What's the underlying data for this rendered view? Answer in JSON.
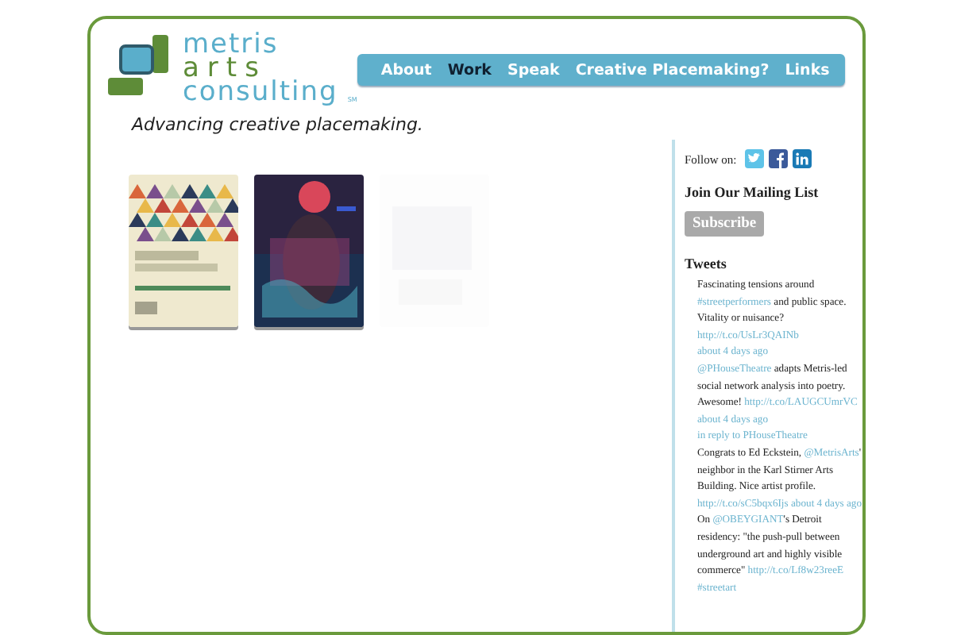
{
  "logo": {
    "lines": [
      "metris",
      "arts",
      "consulting"
    ],
    "mark": "SM"
  },
  "tagline": "Advancing creative placemaking.",
  "nav": [
    {
      "label": "About",
      "selected": false
    },
    {
      "label": "Work",
      "selected": true
    },
    {
      "label": "Speak",
      "selected": false
    },
    {
      "label": "Creative Placemaking?",
      "selected": false
    },
    {
      "label": "Links",
      "selected": false
    }
  ],
  "sidebar": {
    "follow_label": "Follow on:",
    "mailing_title": "Join Our Mailing List",
    "subscribe": "Subscribe",
    "tweets_title": "Tweets",
    "tweets": [
      [
        {
          "kind": "text",
          "text": "Fascinating tensions around "
        },
        {
          "kind": "link",
          "text": "#streetperformers"
        },
        {
          "kind": "text",
          "text": " and public space. Vitality or nuisance? "
        },
        {
          "kind": "link",
          "text": "http://t.co/UsLr3QAINb"
        },
        {
          "kind": "link",
          "text": "about 4 days ago"
        }
      ],
      [
        {
          "kind": "link",
          "text": "@PHouseTheatre"
        },
        {
          "kind": "text",
          "text": " adapts Metris-led social network analysis into poetry. Awesome! "
        },
        {
          "kind": "link",
          "text": "http://t.co/LAUGCUmrVC"
        },
        {
          "kind": "link",
          "text": "about 4 days ago"
        },
        {
          "kind": "link",
          "text": "in reply to PHouseTheatre"
        }
      ],
      [
        {
          "kind": "text",
          "text": "Congrats to Ed Eckstein, "
        },
        {
          "kind": "link",
          "text": "@MetrisArts"
        },
        {
          "kind": "text",
          "text": "' neighbor in the Karl Stirner Arts Building. Nice artist profile. "
        },
        {
          "kind": "link",
          "text": "http://t.co/sC5bqx6Ijs"
        },
        {
          "kind": "link",
          "text": "about 4 days ago"
        }
      ],
      [
        {
          "kind": "text",
          "text": "On "
        },
        {
          "kind": "link",
          "text": "@OBEYGIANT"
        },
        {
          "kind": "text",
          "text": "'s Detroit residency: \"the push-pull between underground art and highly visible commerce\" "
        },
        {
          "kind": "link",
          "text": "http://t.co/Lf8w23reeE"
        },
        {
          "kind": "link",
          "text": "#streetart"
        }
      ]
    ]
  }
}
